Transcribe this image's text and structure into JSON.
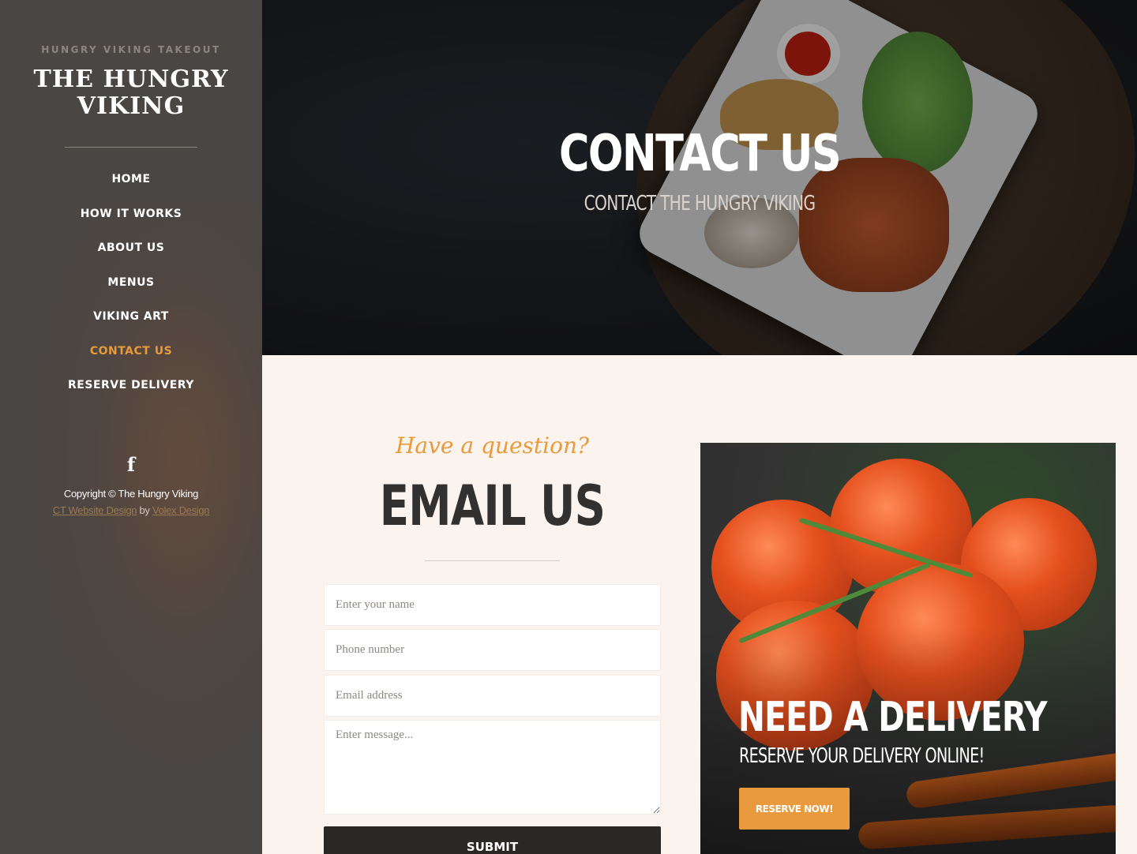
{
  "sidebar": {
    "tagline": "HUNGRY VIKING TAKEOUT",
    "logo_line1": "THE HUNGRY",
    "logo_line2": "VIKING",
    "nav": [
      {
        "label": "HOME",
        "active": false
      },
      {
        "label": "HOW IT WORKS",
        "active": false
      },
      {
        "label": "ABOUT US",
        "active": false
      },
      {
        "label": "MENUS",
        "active": false
      },
      {
        "label": "VIKING ART",
        "active": false
      },
      {
        "label": "CONTACT US",
        "active": true
      },
      {
        "label": "RESERVE DELIVERY",
        "active": false
      }
    ],
    "social_icon": "facebook-icon",
    "social_glyph": "f",
    "copyright": "Copyright © The Hungry Viking",
    "credit_link1": "CT Website Design",
    "credit_by": "by",
    "credit_link2": "Volex Design"
  },
  "hero": {
    "title": "CONTACT US",
    "subtitle": "CONTACT THE HUNGRY VIKING"
  },
  "contact": {
    "script_heading": "Have a question?",
    "heading": "EMAIL US",
    "name_placeholder": "Enter your name",
    "phone_placeholder": "Phone number",
    "email_placeholder": "Email address",
    "message_placeholder": "Enter message...",
    "submit_label": "SUBMIT"
  },
  "delivery": {
    "title": "NEED A DELIVERY",
    "subtitle": "RESERVE YOUR DELIVERY ONLINE!",
    "button_label": "RESERVE NOW!"
  },
  "colors": {
    "accent": "#e89a3c",
    "sidebar_bg": "#4a4643",
    "page_bg": "#faf3ee",
    "dark_text": "#333030"
  }
}
